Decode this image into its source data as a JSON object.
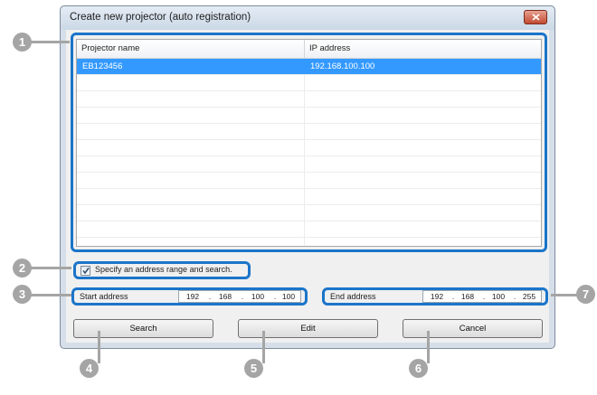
{
  "dialog": {
    "title": "Create new projector (auto registration)"
  },
  "list": {
    "columns": [
      "Projector name",
      "IP address"
    ],
    "rows": [
      {
        "name": "EB123456",
        "ip": "192.168.100.100",
        "selected": true
      },
      {
        "name": "",
        "ip": ""
      },
      {
        "name": "",
        "ip": ""
      },
      {
        "name": "",
        "ip": ""
      },
      {
        "name": "",
        "ip": ""
      },
      {
        "name": "",
        "ip": ""
      },
      {
        "name": "",
        "ip": ""
      },
      {
        "name": "",
        "ip": ""
      },
      {
        "name": "",
        "ip": ""
      },
      {
        "name": "",
        "ip": ""
      },
      {
        "name": "",
        "ip": ""
      },
      {
        "name": "",
        "ip": ""
      }
    ]
  },
  "range": {
    "checkbox_label": "Specify an address range and search.",
    "checked": true,
    "start_label": "Start address",
    "start_ip": [
      "192",
      "168",
      "100",
      "100"
    ],
    "end_label": "End address",
    "end_ip": [
      "192",
      "168",
      "100",
      "255"
    ],
    "separator": "."
  },
  "buttons": {
    "search": "Search",
    "edit": "Edit",
    "cancel": "Cancel"
  },
  "callouts": [
    "1",
    "2",
    "3",
    "4",
    "5",
    "6",
    "7"
  ],
  "colors": {
    "highlight": "#1b75c9",
    "selection": "#3399ff",
    "callout": "#a5a5a5"
  }
}
